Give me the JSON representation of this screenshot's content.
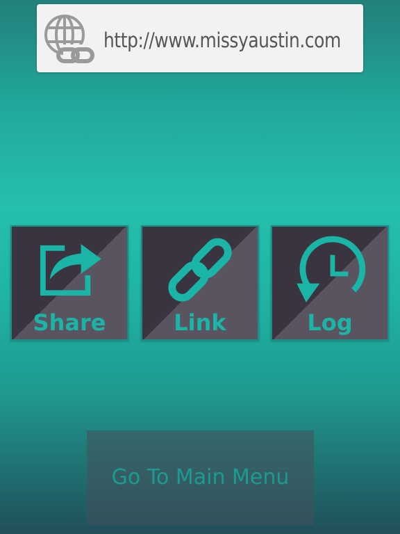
{
  "url_bar": {
    "url": "http://www.missyaustin.com",
    "icon": "globe-link-icon"
  },
  "tiles": [
    {
      "label": "Share",
      "icon": "share-icon"
    },
    {
      "label": "Link",
      "icon": "link-icon"
    },
    {
      "label": "Log",
      "icon": "history-clock-icon"
    }
  ],
  "main_menu_button": {
    "label": "Go To Main Menu"
  },
  "colors": {
    "accent": "#1ab5a6",
    "tile_dark": "#3a3440",
    "tile_light": "#5a5460",
    "url_bar_bg": "#f2f2f2",
    "url_text": "#555555"
  }
}
